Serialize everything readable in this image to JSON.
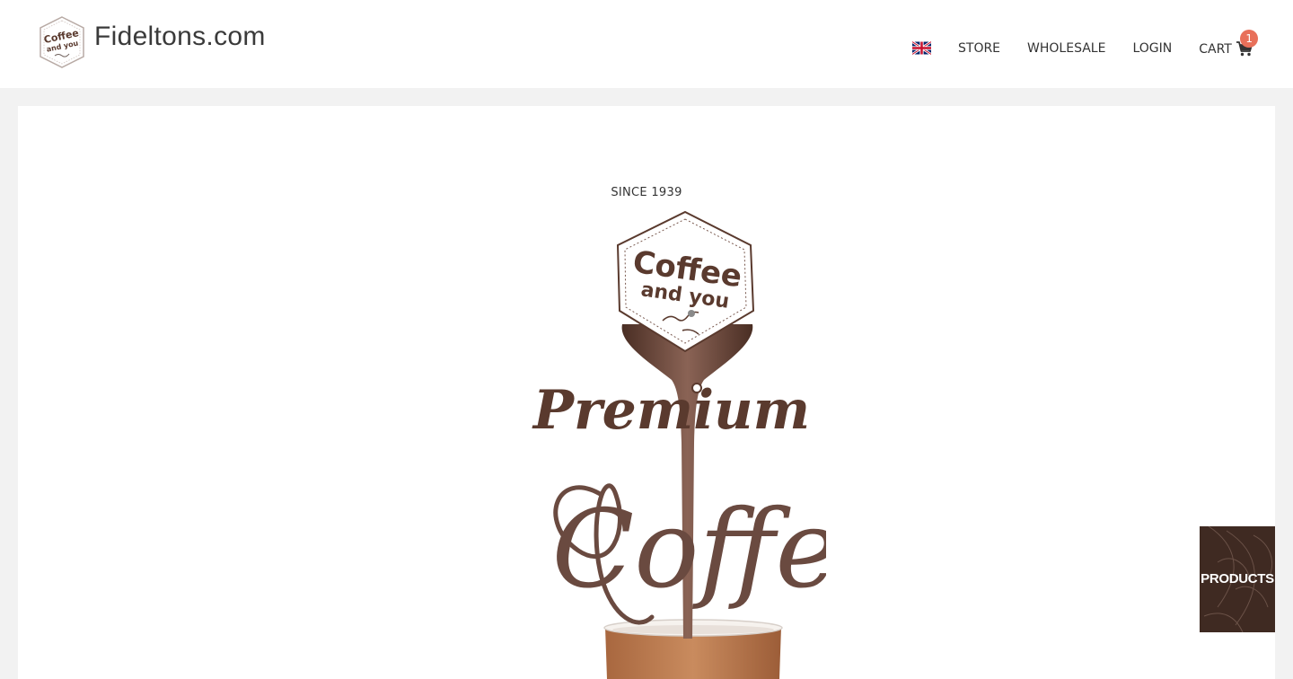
{
  "header": {
    "site_name": "Fideltons.com",
    "logo": {
      "line1": "Coffee",
      "line2": "and you",
      "icon": "brand-logo-icon"
    },
    "language_flag": "uk-flag-icon"
  },
  "nav": {
    "store": "STORE",
    "wholesale": "WHOLESALE",
    "login": "LOGIN",
    "cart_label": "CART",
    "cart_count": "1",
    "cart_icon": "shopping-cart-icon"
  },
  "hero": {
    "since": "SINCE 1939",
    "badge_line1": "Coffee",
    "badge_line2": "and you",
    "headline": "Premium",
    "subheadline": "Coffee"
  },
  "side_tab": {
    "label": "PRODUCTS"
  },
  "colors": {
    "coffee_brown": "#5a3a2e",
    "badge_accent": "#e8705a",
    "tab_background": "#3f2a22",
    "page_background": "#f2f2f2"
  }
}
